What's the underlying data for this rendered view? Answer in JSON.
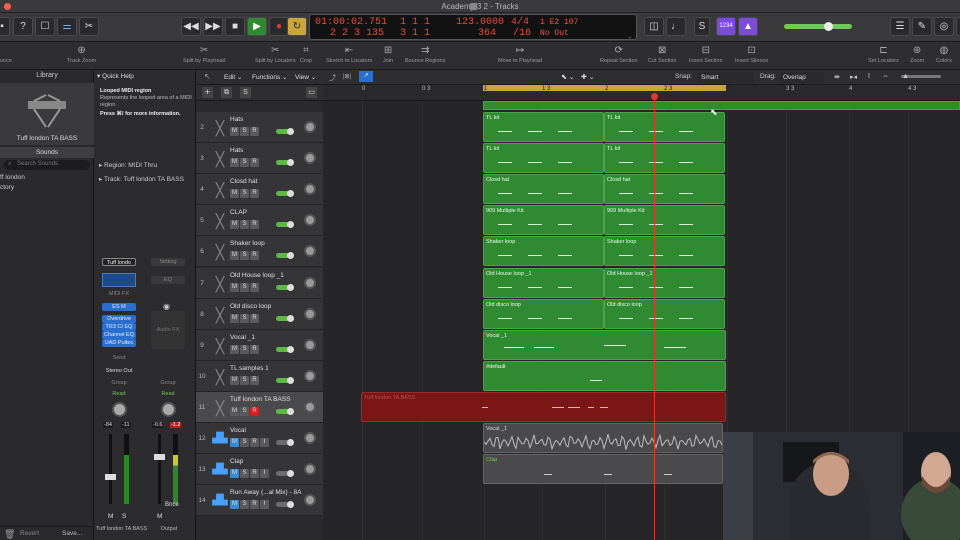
{
  "window": {
    "title": "Academy 3 2 - Tracks"
  },
  "lcd": {
    "position_time": "01:00:02.751",
    "position_bars": "1 1 1",
    "position_beats": "2 2 3 135",
    "locator_start": "1 1 1",
    "locator_end": "3 1 1",
    "tempo": "123.0000",
    "time_sig": "4/4",
    "key_div": "364",
    "division": "/16",
    "midi_in": "1 E2 107",
    "midi_out": "No Out"
  },
  "control": {
    "badge_1234": "1234"
  },
  "toolbar": {
    "items": [
      {
        "label": "Track Zoom",
        "icon": "zoom-icon"
      },
      {
        "label": "Split by Playhead",
        "icon": "scissors-icon"
      },
      {
        "label": "Split by Locators",
        "icon": "scissors-icon"
      },
      {
        "label": "Crop",
        "icon": "crop-icon"
      },
      {
        "label": "Stretch to Locators",
        "icon": "stretch-icon"
      },
      {
        "label": "Join",
        "icon": "join-icon"
      },
      {
        "label": "Bounce Regions",
        "icon": "bounce-icon"
      },
      {
        "label": "Move to Playhead",
        "icon": "move-icon"
      },
      {
        "label": "Repeat Section",
        "icon": "repeat-icon"
      },
      {
        "label": "Cut Section",
        "icon": "cut-icon"
      },
      {
        "label": "Insert Section",
        "icon": "insert-icon"
      },
      {
        "label": "Insert Silence",
        "icon": "silence-icon"
      },
      {
        "label": "Set Locators",
        "icon": "locators-icon"
      },
      {
        "label": "Zoom",
        "icon": "zoom-icon"
      },
      {
        "label": "Colors",
        "icon": "palette-icon"
      }
    ],
    "left_cut": "unce"
  },
  "library": {
    "title": "Library",
    "instrument_name": "Tuff london TA BASS",
    "sounds_label": "Sounds",
    "search_placeholder": "Search Sounds",
    "list": [
      "ff london",
      "ctory"
    ]
  },
  "inspector": {
    "quick_help_title": "Quick Help",
    "help_heading": "Looped MIDI region",
    "help_body": "Represents the looped area of a MIDI region.",
    "help_more": "Press ⌘/ for more information.",
    "region_label": "Region: MIDI Thru",
    "track_label": "Track: Tuff london TA BASS",
    "strip1": {
      "name": "Tuff london TA BASS",
      "setting": "Tuff londo",
      "midifx": "MIDI FX",
      "instrument": "ES M",
      "plugins": [
        "Overdrive",
        "TR3 CI EQ",
        "Channel EQ",
        "UAD Pultec"
      ],
      "send": "Send",
      "output": "Stereo Out",
      "group": "Group",
      "auto": "Read",
      "vol": "-84",
      "peak": "-11"
    },
    "strip2": {
      "name": "Output",
      "setting": "Setting",
      "eq": "EQ",
      "audiofx": "Audio FX",
      "group": "Group",
      "auto": "Read",
      "vol": "-0.6",
      "peak": "-1.2",
      "bnce": "Bnce"
    },
    "ms": [
      "M",
      "S"
    ],
    "revert": "Revert",
    "save": "Save..."
  },
  "menubar": {
    "edit": "Edit",
    "functions": "Functions",
    "view": "View",
    "snap_label": "Snap:",
    "snap_value": "Smart",
    "drag_label": "Drag:",
    "drag_value": "Overlap"
  },
  "header": {
    "add": "+",
    "s_label": "S"
  },
  "ruler": [
    "0",
    "0 3",
    "1",
    "1 3",
    "2",
    "2 3",
    "3",
    "3 3",
    "4",
    "4 3"
  ],
  "tracks": [
    {
      "num": "2",
      "name": "Hats",
      "sel": false,
      "rec": false,
      "kind": "midi"
    },
    {
      "num": "3",
      "name": "Hats",
      "sel": false,
      "rec": false,
      "kind": "midi"
    },
    {
      "num": "4",
      "name": "Closd hat",
      "sel": false,
      "rec": false,
      "kind": "midi"
    },
    {
      "num": "5",
      "name": "CLAP",
      "sel": false,
      "rec": false,
      "kind": "midi"
    },
    {
      "num": "6",
      "name": "Shaker loop",
      "sel": false,
      "rec": false,
      "kind": "midi"
    },
    {
      "num": "7",
      "name": "Old House loop _1",
      "sel": false,
      "rec": false,
      "kind": "midi"
    },
    {
      "num": "8",
      "name": "Old disco  loop",
      "sel": false,
      "rec": false,
      "kind": "midi"
    },
    {
      "num": "9",
      "name": "Vocal _1",
      "sel": false,
      "rec": false,
      "kind": "midi"
    },
    {
      "num": "10",
      "name": "TL samples 1",
      "sel": false,
      "rec": false,
      "kind": "midi"
    },
    {
      "num": "11",
      "name": "Tuff london TA BASS",
      "sel": true,
      "rec": true,
      "kind": "midi"
    },
    {
      "num": "12",
      "name": "Vocal",
      "sel": false,
      "rec": false,
      "kind": "audio"
    },
    {
      "num": "13",
      "name": "Clap",
      "sel": false,
      "rec": false,
      "kind": "audio"
    },
    {
      "num": "14",
      "name": "Run Away (...al Mix) - 8A",
      "sel": false,
      "rec": false,
      "kind": "audio"
    }
  ],
  "regions": {
    "r2a": "TL kit",
    "r2b": "TL kit",
    "r3a": "TL kit",
    "r3b": "TL kit",
    "r4a": "Closd hat",
    "r4b": "Closd hat",
    "r5a": "909 Multiple Kit",
    "r5b": "909 Multiple Kit",
    "r6a": "Shaker loop",
    "r6b": "Shaker loop",
    "r7a": "Old House loop _1",
    "r7b": "Old House loop _1",
    "r8a": "Old disco  loop",
    "r8b": "Old disco  loop",
    "r9": "Vocal _1",
    "r10": "#default",
    "r11": "Tuff london TA BASS",
    "r12": "Vocal _1",
    "r13": "Clap"
  },
  "colors": {
    "region_green": "#2f8a31",
    "region_red": "#8a1a1a",
    "playhead": "#e23a2a",
    "cycle": "#c9a53a"
  }
}
